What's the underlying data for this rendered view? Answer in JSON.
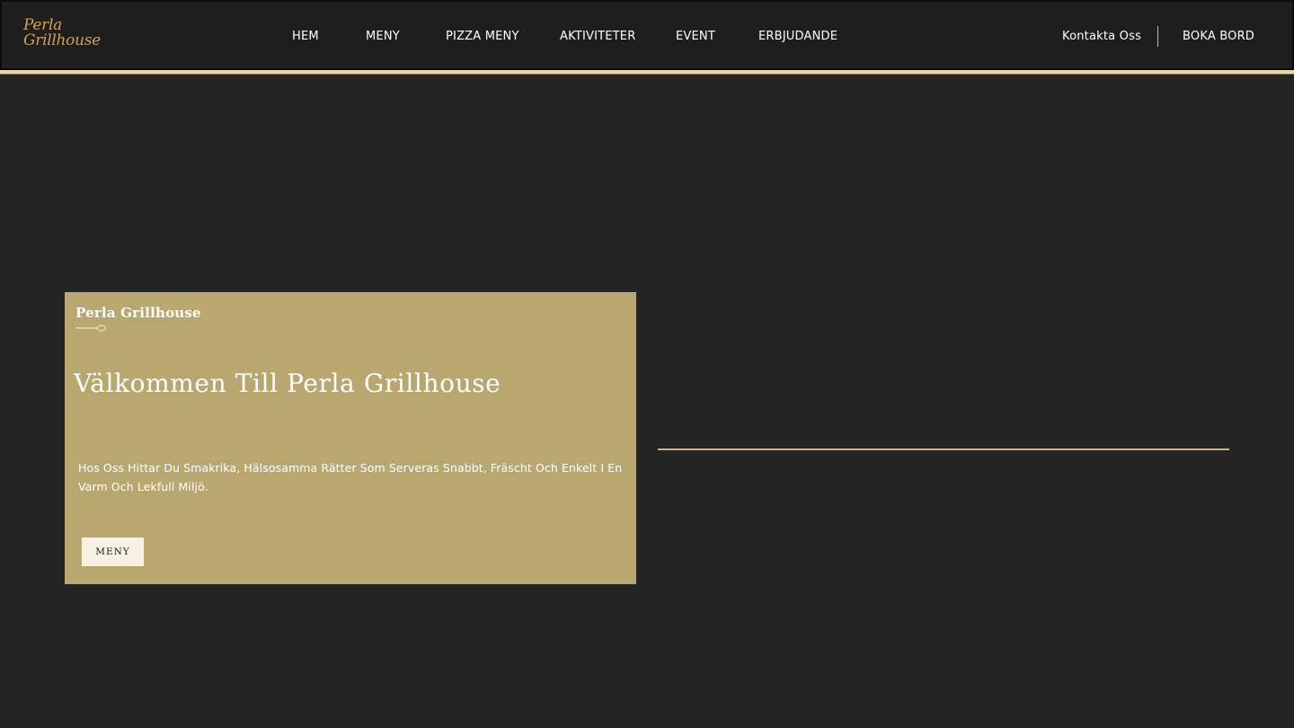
{
  "brand": {
    "logo_line1": "Perla",
    "logo_line2": "Grillhouse",
    "logo_color": "#d7a04e"
  },
  "nav": {
    "items": [
      {
        "label": "HEM"
      },
      {
        "label": "MENY"
      },
      {
        "label": "PIZZA MENY"
      },
      {
        "label": "AKTIVITETER"
      },
      {
        "label": "EVENT"
      },
      {
        "label": "ERBJUDANDE"
      }
    ],
    "contact_label": "Kontakta Oss",
    "book_label": "BOKA BORD"
  },
  "hero": {
    "brand_label": "Perla Grillhouse",
    "title": "Välkommen Till Perla Grillhouse",
    "description": "Hos Oss Hittar Du Smakrika, Hälsosamma Rätter Som Serveras Snabbt, Fräscht Och Enkelt I En Varm Och Lekfull Miljö.",
    "button_label": "MENY"
  },
  "colors": {
    "background": "#242424",
    "header": "#1e1e1e",
    "accent_strip": "#e8d6a6",
    "card": "#b8a870",
    "button": "#f7f1e3"
  }
}
